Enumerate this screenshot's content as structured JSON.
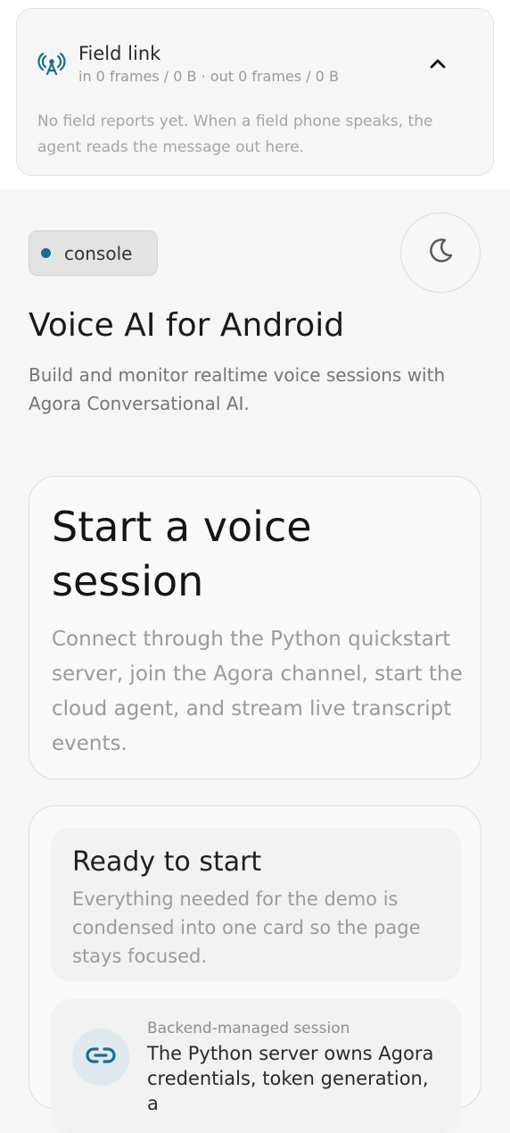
{
  "field_link": {
    "title": "Field link",
    "stats": "in 0 frames / 0 B · out 0 frames / 0 B",
    "empty_message": "No field reports yet. When a field phone speaks, the agent reads the message out here.",
    "icon": "antenna-icon",
    "collapse_icon": "chevron-up-icon"
  },
  "header": {
    "badge_label": "console",
    "badge_dot_color": "#0f6f92",
    "theme_icon": "moon-icon"
  },
  "page": {
    "title": "Voice AI for Android",
    "subtitle": "Build and monitor realtime voice sessions with Agora Conversational AI."
  },
  "start_card": {
    "title": "Start a voice session",
    "description": "Connect through the Python quickstart server, join the Agora channel, start the cloud agent, and stream live transcript events."
  },
  "ready_card": {
    "title": "Ready to start",
    "description": "Everything needed for the demo is condensed into one card so the page stays focused.",
    "backend": {
      "kicker": "Backend-managed session",
      "text": "The Python server owns Agora credentials, token generation, a",
      "icon": "link-icon"
    }
  },
  "colors": {
    "accent": "#0f6f92",
    "link_circle": "#dfe9ee"
  }
}
